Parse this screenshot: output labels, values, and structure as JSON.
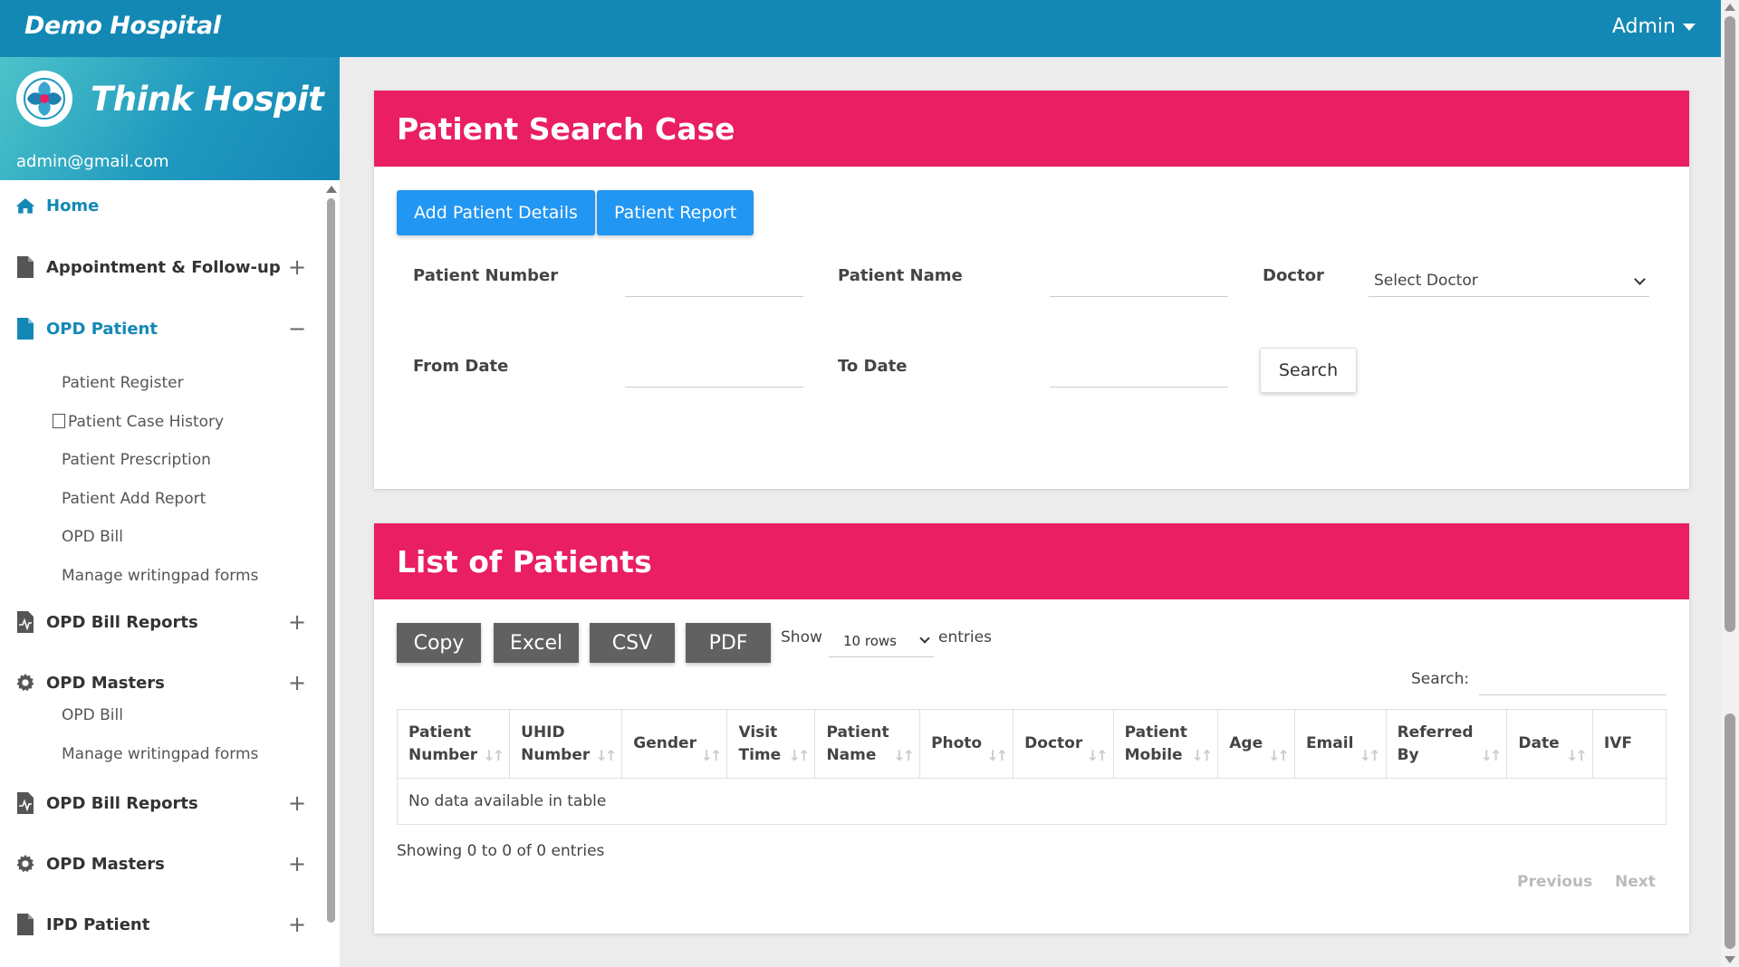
{
  "topbar": {
    "brand": "Demo Hospital",
    "user": "Admin"
  },
  "sidebar": {
    "title": "Think Hospit",
    "email": "admin@gmail.com",
    "menu": {
      "home": "Home",
      "appointment": "Appointment & Follow-up",
      "opd_patient": "OPD Patient",
      "opd_sub": [
        "Patient Register",
        "Patient Case History",
        "Patient Prescription",
        "Patient Add Report",
        "OPD Bill",
        "Manage writingpad forms"
      ],
      "opd_bill_reports": "OPD Bill Reports",
      "opd_masters": "OPD Masters",
      "opd_masters_sub": [
        "OPD Bill",
        "Manage writingpad forms"
      ],
      "opd_bill_reports_2": "OPD Bill Reports",
      "opd_masters_2": "OPD Masters",
      "ipd_patient": "IPD Patient"
    },
    "toggle_plus": "+",
    "toggle_minus": "−"
  },
  "search_card": {
    "title": "Patient Search Case",
    "add_button": "Add Patient Details",
    "report_button": "Patient Report",
    "labels": {
      "patient_number": "Patient Number",
      "patient_name": "Patient Name",
      "doctor": "Doctor",
      "from_date": "From Date",
      "to_date": "To Date"
    },
    "doctor_select": "Select Doctor",
    "search_button": "Search"
  },
  "list_card": {
    "title": "List of Patients",
    "export_buttons": [
      "Copy",
      "Excel",
      "CSV",
      "PDF"
    ],
    "show_label": "Show",
    "rows_select": "10 rows",
    "entries_label": "entries",
    "search_label": "Search:",
    "columns": [
      [
        "Patient",
        "Number"
      ],
      [
        "UHID",
        "Number"
      ],
      [
        "",
        "Gender"
      ],
      [
        "Visit",
        "Time"
      ],
      [
        "Patient",
        "Name"
      ],
      [
        "",
        "Photo"
      ],
      [
        "",
        "Doctor"
      ],
      [
        "Patient",
        "Mobile"
      ],
      [
        "",
        "Age"
      ],
      [
        "",
        "Email"
      ],
      [
        "Referred",
        "By"
      ],
      [
        "",
        "Date"
      ],
      [
        "",
        "IVF"
      ]
    ],
    "empty_message": "No data available in table",
    "showing": "Showing 0 to 0 of 0 entries",
    "previous": "Previous",
    "next": "Next"
  },
  "colors": {
    "topbar": "#1488b5",
    "card_header": "#e91e63",
    "primary_button": "#2196f3",
    "export_button": "#616161"
  }
}
